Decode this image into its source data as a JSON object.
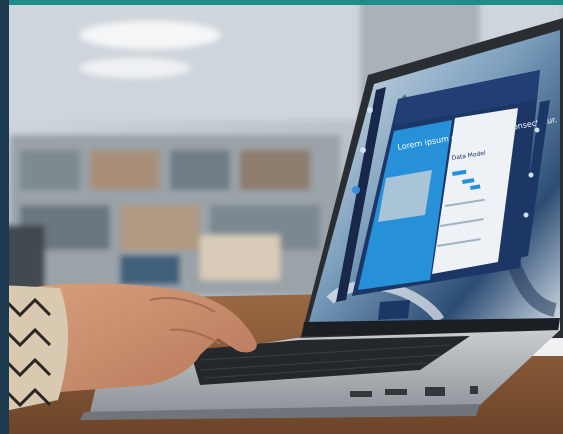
{
  "screen_content": {
    "hero_text": "Lorem ipsum dolor sit amet consectetur.",
    "panel_title": "Data Model"
  },
  "colors": {
    "top_strip": "#1e8c88",
    "left_strip": "#1b3a4d",
    "desk": "#8b5a35",
    "laptop_body": "#b9bec4",
    "screen_accent": "#1f7fd1",
    "screen_dark": "#19305a"
  }
}
